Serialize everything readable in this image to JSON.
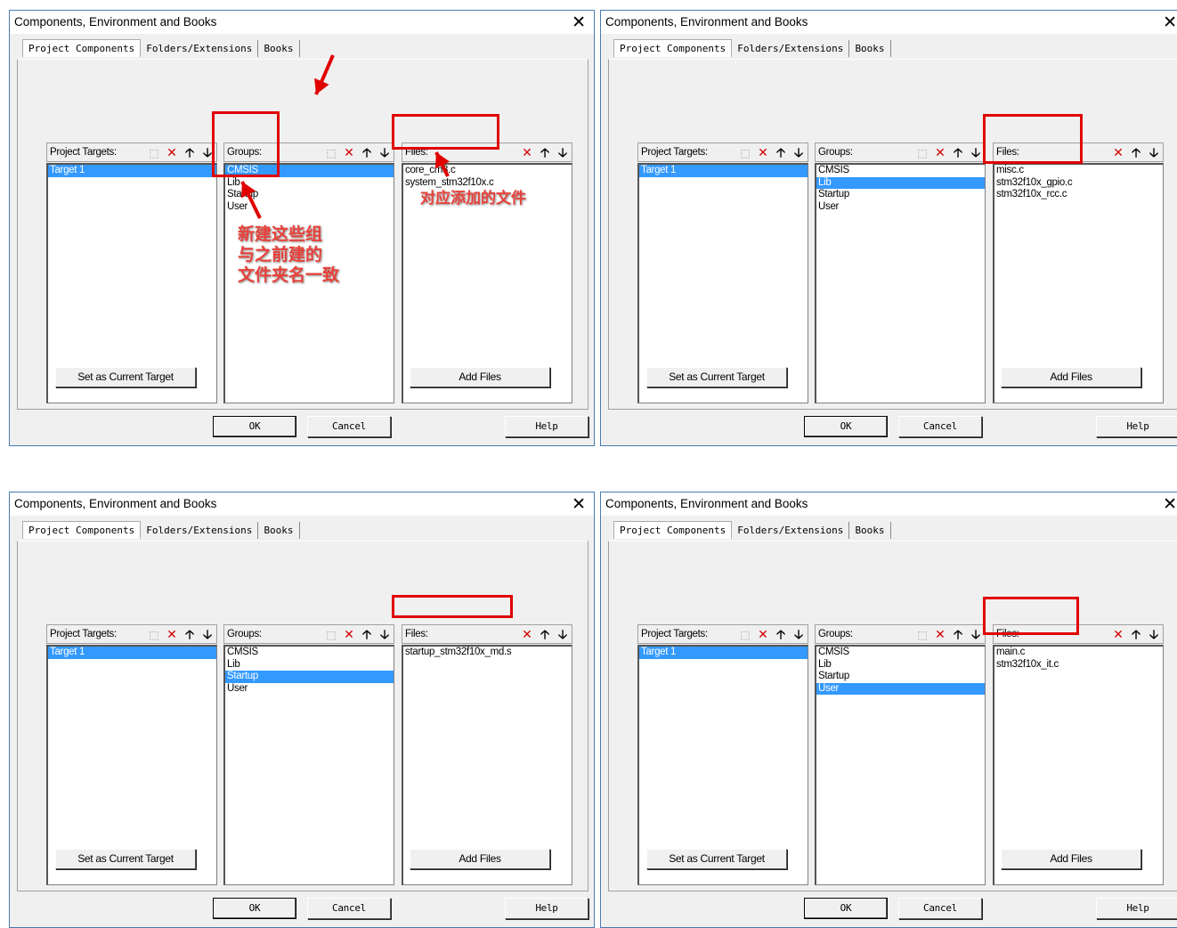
{
  "dialog_title": "Components, Environment and Books",
  "close_glyph": "✕",
  "tabs": [
    "Project Components",
    "Folders/Extensions",
    "Books"
  ],
  "labels": {
    "targets": "Project Targets:",
    "groups": "Groups:",
    "files": "Files:"
  },
  "icons": {
    "new": "new-item-icon",
    "delete": "delete-icon",
    "up": "move-up-icon",
    "down": "move-down-icon"
  },
  "buttons": {
    "set_current": "Set as Current Target",
    "add_files": "Add Files",
    "ok": "OK",
    "cancel": "Cancel",
    "help": "Help"
  },
  "targets": [
    "Target 1"
  ],
  "groups": [
    "CMSIS",
    "Lib",
    "Startup",
    "User"
  ],
  "dialogs": [
    {
      "selected_group": 0,
      "files": [
        "core_cm3.c",
        "system_stm32f10x.c"
      ]
    },
    {
      "selected_group": 1,
      "files": [
        "misc.c",
        "stm32f10x_gpio.c",
        "stm32f10x_rcc.c"
      ]
    },
    {
      "selected_group": 2,
      "files": [
        "startup_stm32f10x_md.s"
      ]
    },
    {
      "selected_group": 3,
      "files": [
        "main.c",
        "stm32f10x_it.c"
      ]
    }
  ],
  "annotations": {
    "files_note": "对应添加的文件",
    "groups_note": "新建这些组\n与之前建的\n文件夹名一致"
  },
  "colors": {
    "selection": "#3399ff",
    "highlight_box": "#e00000",
    "annotation_text": "#e8413a"
  }
}
